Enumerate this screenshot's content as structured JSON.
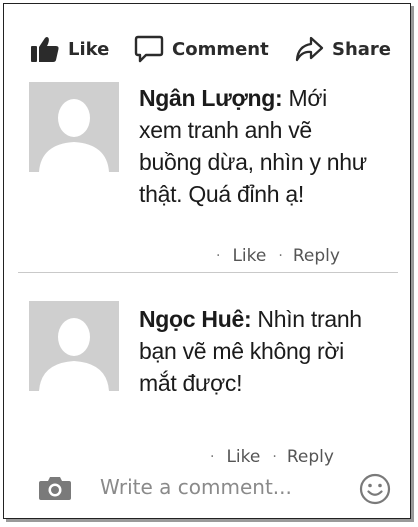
{
  "actions": {
    "like_label": "Like",
    "comment_label": "Comment",
    "share_label": "Share"
  },
  "comments": [
    {
      "author": "Ngân Lượng:",
      "text_lines": [
        "Mới",
        "xem tranh anh vẽ",
        "buồng dừa, nhìn y như",
        "thật. Quá đỉnh ạ!"
      ],
      "like_label": "Like",
      "reply_label": "Reply"
    },
    {
      "author": "Ngọc Huê:",
      "text_lines": [
        "Nhìn tranh",
        "bạn vẽ mê không rời",
        "mắt được!"
      ],
      "like_label": "Like",
      "reply_label": "Reply"
    }
  ],
  "composer": {
    "placeholder": "Write a comment..."
  },
  "icons": {
    "like": "thumbs-up-icon",
    "comment": "speech-bubble-icon",
    "share": "share-arrow-icon",
    "camera": "camera-icon",
    "emoji": "smiley-icon",
    "avatar": "default-avatar"
  },
  "colors": {
    "icon_gray": "#2b2b2b",
    "meta_gray": "#555555",
    "avatar_bg": "#cfcfcf"
  }
}
